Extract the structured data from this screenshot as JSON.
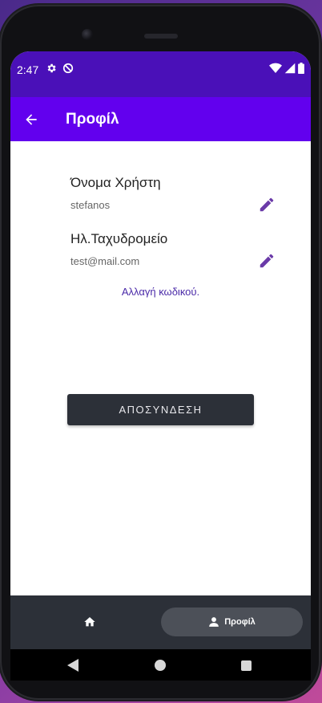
{
  "status_bar": {
    "time": "2:47",
    "icons": [
      "settings-icon",
      "sync-icon",
      "wifi-icon",
      "signal-icon",
      "battery-icon"
    ]
  },
  "app_bar": {
    "title": "Προφίλ",
    "back_icon": "arrow-back-icon"
  },
  "profile": {
    "username_label": "Όνομα Χρήστη",
    "username_value": "stefanos",
    "email_label": "Ηλ.Ταχυδρομείο",
    "email_value": "test@mail.com",
    "edit_icon": "pencil-icon",
    "change_password_link": "Αλλαγή κωδικού."
  },
  "logout_button": {
    "label": "ΑΠΟΣΥΝΔΕΣΗ"
  },
  "bottom_nav": {
    "items": [
      {
        "icon": "home-icon",
        "label": "",
        "selected": false
      },
      {
        "icon": "person-icon",
        "label": "Προφίλ",
        "selected": true
      }
    ]
  },
  "colors": {
    "status_bar": "#4a10b8",
    "app_bar": "#6200ee",
    "edit_icon": "#6a3aa8",
    "link": "#4a2aa8",
    "logout_button": "#2c3038",
    "bottom_nav": "#2c3038",
    "nav_selected_pill": "#4c5058"
  }
}
